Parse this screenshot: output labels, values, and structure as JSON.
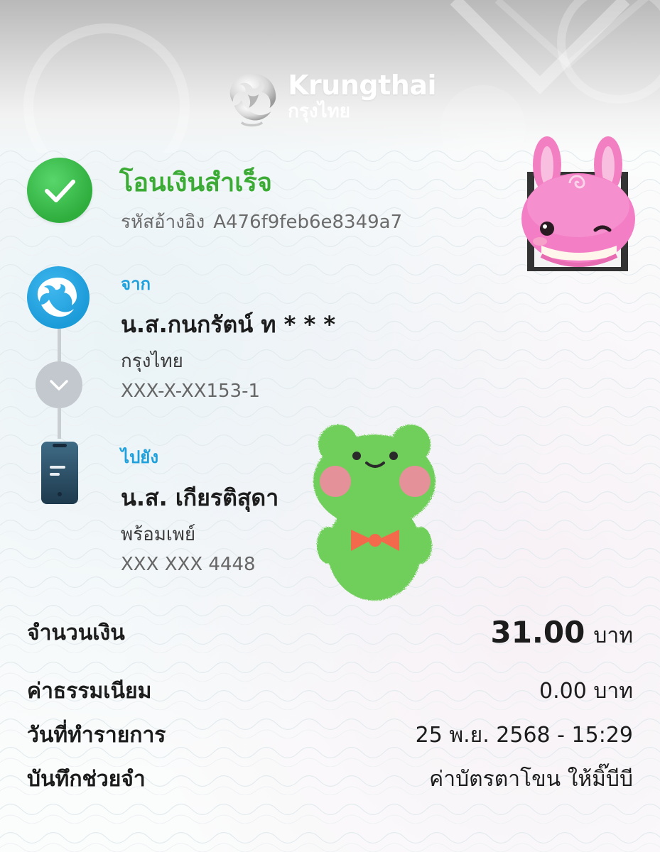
{
  "brand": {
    "name_en": "Krungthai",
    "name_th": "กรุงไทย"
  },
  "status": {
    "title": "โอนเงินสำเร็จ",
    "ref_label": "รหัสอ้างอิง",
    "ref_code": "A476f9feb6e8349a7",
    "color": "#3bab35"
  },
  "from": {
    "label": "จาก",
    "name": "น.ส.กนกรัตน์ ท * * *",
    "bank": "กรุงไทย",
    "account": "XXX-X-XX153-1"
  },
  "to": {
    "label": "ไปยัง",
    "name": "น.ส. เกียรติสุดา",
    "service": "พร้อมเพย์",
    "account": "XXX XXX 4448"
  },
  "details": {
    "amount_label": "จำนวนเงิน",
    "amount_value": "31.00",
    "amount_unit": "บาท",
    "fee_label": "ค่าธรรมเนียม",
    "fee_value": "0.00 บาท",
    "date_label": "วันที่ทำรายการ",
    "date_value": "25 พ.ย. 2568 - 15:29",
    "memo_label": "บันทึกช่วยจำ",
    "memo_value": "ค่าบัตรตาโขน ให้มิ๊บีบี"
  },
  "colors": {
    "accent_blue": "#1da0dc",
    "success_green": "#3bab35"
  },
  "icons": [
    "success-check-icon",
    "krungthai-bird-icon",
    "chevron-down-icon",
    "mobile-phone-icon"
  ]
}
